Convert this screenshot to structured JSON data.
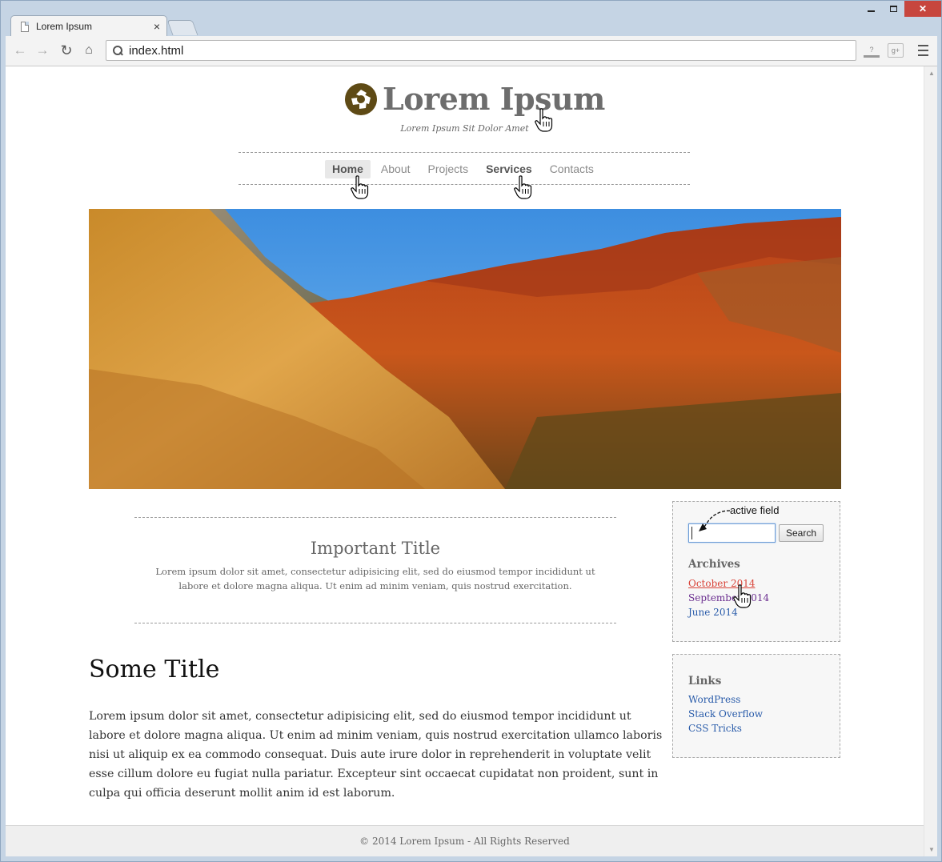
{
  "browser": {
    "tab_title": "Lorem Ipsum",
    "tab_close": "×",
    "url": "index.html",
    "nav_back": "←",
    "nav_forward": "→",
    "nav_reload": "↻",
    "nav_home": "⌂",
    "ext_1": "?",
    "ext_2": "g+"
  },
  "site": {
    "title": "Lorem Ipsum",
    "tagline": "Lorem Ipsum Sit Dolor Amet",
    "logo_color": "#5e4a15",
    "nav": [
      {
        "label": "Home",
        "state": "active"
      },
      {
        "label": "About",
        "state": "normal"
      },
      {
        "label": "Projects",
        "state": "normal"
      },
      {
        "label": "Services",
        "state": "hover"
      },
      {
        "label": "Contacts",
        "state": "normal"
      }
    ]
  },
  "intro": {
    "title": "Important Title",
    "text": "Lorem ipsum dolor sit amet, consectetur adipisicing elit, sed do eiusmod tempor incididunt ut labore et dolore magna aliqua. Ut enim ad minim veniam, quis nostrud exercitation."
  },
  "article": {
    "title": "Some Title",
    "text": "Lorem ipsum dolor sit amet, consectetur adipisicing elit, sed do eiusmod tempor incididunt ut labore et dolore magna aliqua. Ut enim ad minim veniam, quis nostrud exercitation ullamco laboris nisi ut aliquip ex ea commodo consequat. Duis aute irure dolor in reprehenderit in voluptate velit esse cillum dolore eu fugiat nulla pariatur. Excepteur sint occaecat cupidatat non proident, sunt in culpa qui officia deserunt mollit anim id est laborum."
  },
  "sidebar": {
    "annotation": "active field",
    "search_value": "",
    "search_button": "Search",
    "archives_heading": "Archives",
    "archives": [
      {
        "label": "October 2014",
        "state": "hovered"
      },
      {
        "label": "September 2014",
        "state": "visited"
      },
      {
        "label": "June 2014",
        "state": "normal"
      }
    ],
    "links_heading": "Links",
    "links": [
      {
        "label": "WordPress"
      },
      {
        "label": "Stack Overflow"
      },
      {
        "label": "CSS Tricks"
      }
    ]
  },
  "footer": {
    "text": "© 2014 Lorem Ipsum - All Rights Reserved"
  },
  "colors": {
    "link": "#2a5caa",
    "link_visited": "#6a2d8f",
    "link_hover": "#d9453a",
    "focus_ring": "#6b9bd6",
    "close_button": "#c7463e"
  }
}
